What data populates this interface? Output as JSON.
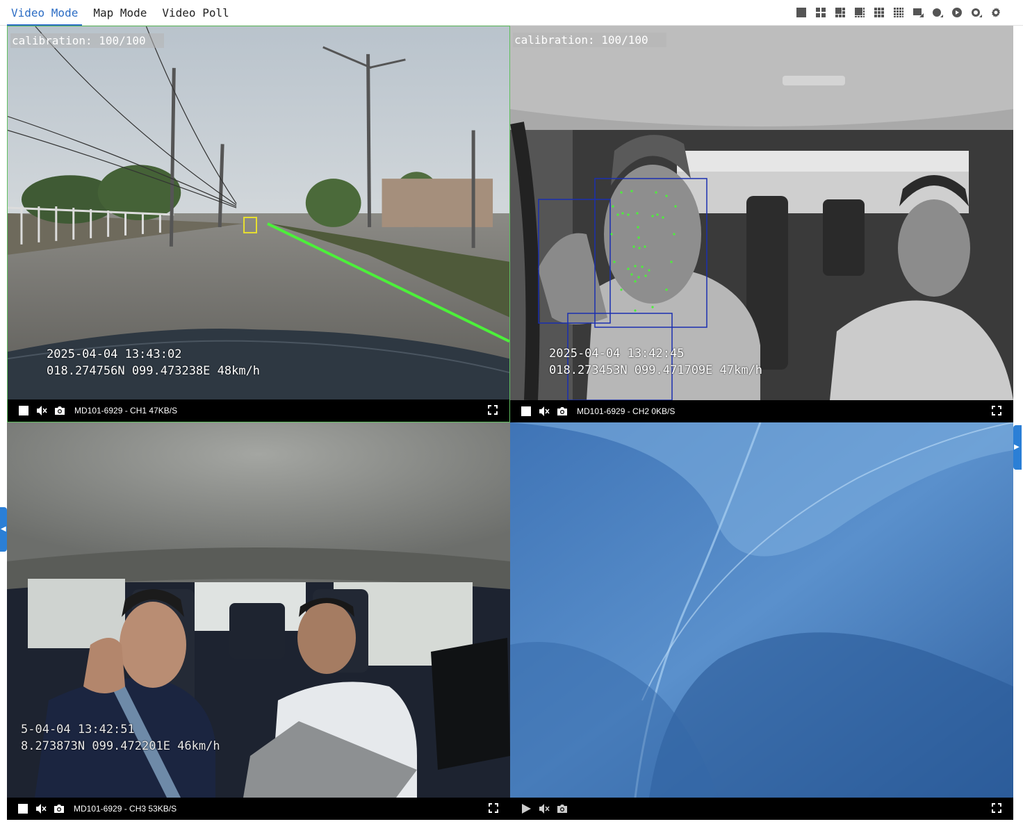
{
  "tabs": [
    {
      "label": "Video Mode",
      "active": true
    },
    {
      "label": "Map Mode",
      "active": false
    },
    {
      "label": "Video Poll",
      "active": false
    }
  ],
  "toolbar": {
    "buttons": [
      "layout-1-icon",
      "layout-4-icon",
      "layout-6-icon",
      "layout-8-icon",
      "layout-9-icon",
      "layout-16-icon",
      "custom-layout-icon",
      "stop-all-icon",
      "play-all-icon",
      "record-icon",
      "settings-icon"
    ]
  },
  "channels": [
    {
      "calibration": "calibration: 100/100",
      "osd_time": "2025-04-04 13:43:02",
      "osd_gps": "018.274756N 099.473238E 48km/h",
      "label": "MD101-6929 - CH1 47KB/S",
      "state": "playing"
    },
    {
      "calibration": "calibration: 100/100",
      "osd_time": "2025-04-04 13:42:45",
      "osd_gps": "018.273453N 099.471709E 47km/h",
      "label": "MD101-6929 - CH2 0KB/S",
      "state": "playing"
    },
    {
      "osd_time": "5-04-04  13:42:51",
      "osd_gps": "8.273873N  099.472201E  46km/h",
      "label": "MD101-6929 - CH3 53KB/S",
      "state": "playing"
    },
    {
      "label": "",
      "state": "idle"
    }
  ],
  "colors": {
    "accent": "#2b6cc4",
    "active_border": "#5fbf5f",
    "lane_line": "#4cf03a",
    "face_box": "#1a2fb0",
    "vehicle_box": "#e8e030"
  }
}
